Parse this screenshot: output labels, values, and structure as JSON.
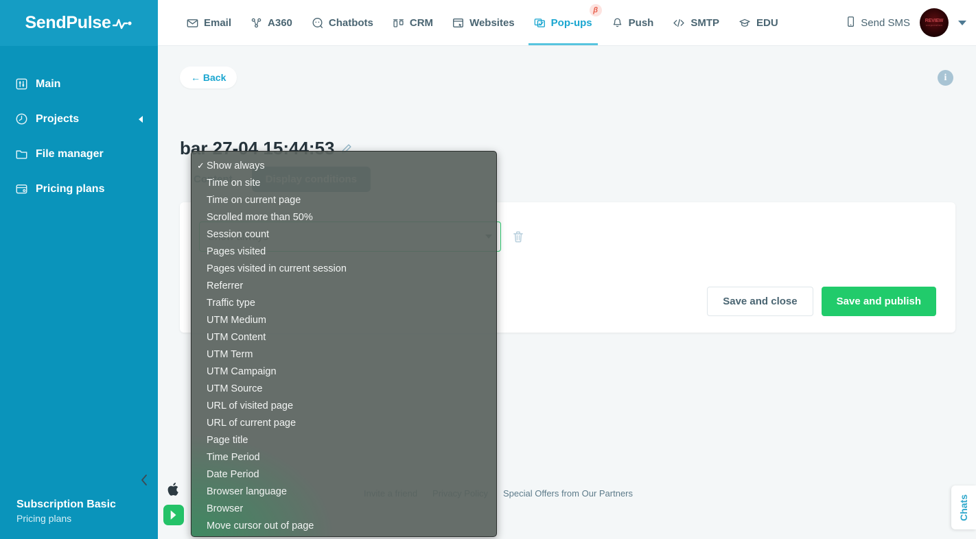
{
  "brand": {
    "logo_text": "SendPulse",
    "accent_color": "#159dc4",
    "sidebar_color": "#0a94bb"
  },
  "topnav": {
    "items": [
      {
        "label": "Email",
        "icon": "envelope-icon",
        "active": false
      },
      {
        "label": "A360",
        "icon": "automation-icon",
        "active": false
      },
      {
        "label": "Chatbots",
        "icon": "chat-bubble-icon",
        "active": false
      },
      {
        "label": "CRM",
        "icon": "crm-icon",
        "active": false
      },
      {
        "label": "Websites",
        "icon": "website-icon",
        "active": false
      },
      {
        "label": "Pop-ups",
        "icon": "popup-icon",
        "active": true,
        "badge": "β"
      },
      {
        "label": "Push",
        "icon": "bell-icon",
        "active": false
      },
      {
        "label": "SMTP",
        "icon": "code-icon",
        "active": false
      },
      {
        "label": "EDU",
        "icon": "graduation-cap-icon",
        "active": false
      }
    ],
    "send_sms_label": "Send SMS",
    "avatar_initials": "REVIEW",
    "avatar_sub": "corporation"
  },
  "sidebar": {
    "items": [
      {
        "label": "Main",
        "icon": "sliders-icon",
        "has_arrow": false
      },
      {
        "label": "Projects",
        "icon": "clock-icon",
        "has_arrow": true
      },
      {
        "label": "File manager",
        "icon": "folder-icon",
        "has_arrow": false
      },
      {
        "label": "Pricing plans",
        "icon": "wallet-icon",
        "has_arrow": false
      }
    ],
    "subscription_title": "Subscription Basic",
    "subscription_link": "Pricing plans"
  },
  "page": {
    "back_label": "← Back",
    "title": "bar 27-04 15:44:53",
    "tabs": [
      {
        "label": "Content",
        "active": false
      },
      {
        "label": "Display conditions",
        "active": true
      }
    ]
  },
  "card": {
    "selected_condition": "Show always",
    "save_close_label": "Save and close",
    "save_publish_label": "Save and publish"
  },
  "dropdown": {
    "selected": "Show always",
    "options": [
      "Show always",
      "Time on site",
      "Time on current page",
      "Scrolled more than 50%",
      "Session count",
      "Pages visited",
      "Pages visited in current session",
      "Referrer",
      "Traffic type",
      "UTM Medium",
      "UTM Content",
      "UTM Term",
      "UTM Campaign",
      "UTM Source",
      "URL of visited page",
      "URL of current page",
      "Page title",
      "Time Period",
      "Date Period",
      "Browser language",
      "Browser",
      "Move cursor out of page"
    ]
  },
  "footer": {
    "links": [
      "Invite a friend",
      "Privacy Policy",
      "Special Offers from Our Partners"
    ]
  },
  "chats_widget": {
    "label": "Chats"
  }
}
